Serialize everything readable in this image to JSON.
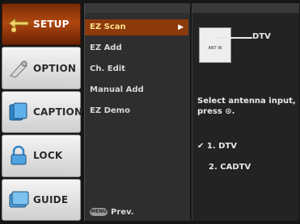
{
  "tabs": [
    {
      "label": "SETUP",
      "icon": "setup-icon",
      "active": true
    },
    {
      "label": "OPTION",
      "icon": "option-icon",
      "active": false
    },
    {
      "label": "CAPTION",
      "icon": "caption-icon",
      "active": false
    },
    {
      "label": "LOCK",
      "icon": "lock-icon",
      "active": false
    },
    {
      "label": "GUIDE",
      "icon": "guide-icon",
      "active": false
    }
  ],
  "menu": {
    "items": [
      {
        "label": "EZ Scan",
        "active": true,
        "arrow": "▶"
      },
      {
        "label": "EZ Add",
        "active": false
      },
      {
        "label": "Ch. Edit",
        "active": false
      },
      {
        "label": "Manual Add",
        "active": false
      },
      {
        "label": "EZ Demo",
        "active": false
      }
    ],
    "prev_key_label": "MENU",
    "prev_label": "Prev."
  },
  "info": {
    "signal_label": "DTV",
    "antenna_label": "ANT IN",
    "instruction": "Select antenna input, press ⊙.",
    "options": [
      {
        "label": "1. DTV",
        "selected": true
      },
      {
        "label": "2. CADTV",
        "selected": false
      }
    ],
    "check_mark": "✔"
  },
  "colors": {
    "active_tab": "#b04710",
    "active_menu_item": "#8c3a0c",
    "active_menu_text": "#ffe089"
  }
}
